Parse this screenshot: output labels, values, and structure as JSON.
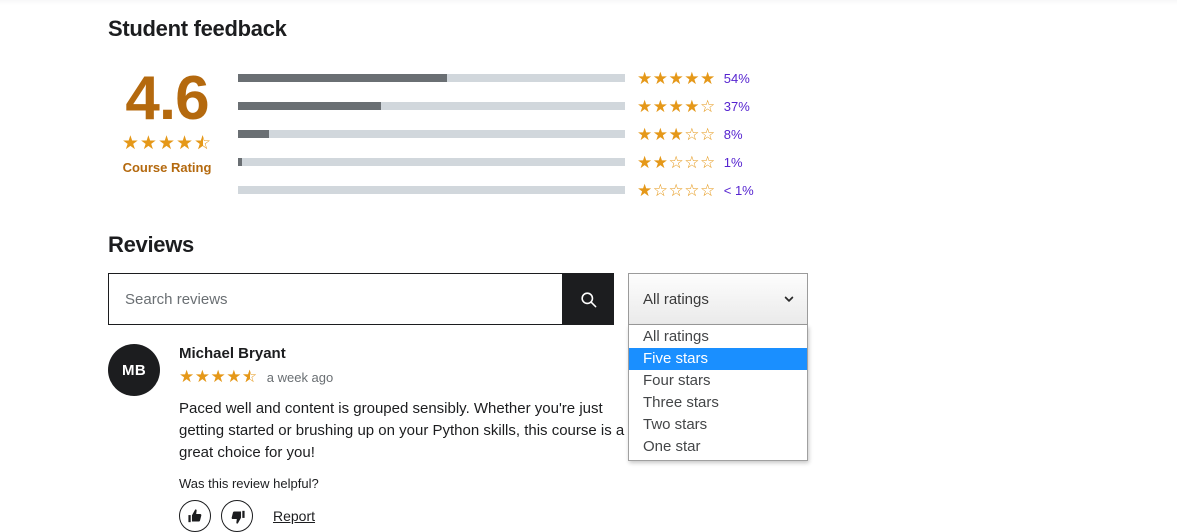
{
  "feedback": {
    "section_title": "Student feedback",
    "average": "4.6",
    "average_stars": 4.6,
    "rating_label": "Course Rating",
    "distribution": [
      {
        "stars": 5,
        "percent_label": "54%",
        "percent": 54
      },
      {
        "stars": 4,
        "percent_label": "37%",
        "percent": 37
      },
      {
        "stars": 3,
        "percent_label": "8%",
        "percent": 8
      },
      {
        "stars": 2,
        "percent_label": "1%",
        "percent": 1
      },
      {
        "stars": 1,
        "percent_label": "< 1%",
        "percent": 0
      }
    ]
  },
  "reviews": {
    "section_title": "Reviews",
    "search": {
      "placeholder": "Search reviews",
      "value": "",
      "button_icon": "search-icon"
    },
    "rating_filter": {
      "selected": "All ratings",
      "chevron_icon": "chevron-down-icon",
      "options": [
        {
          "label": "All ratings",
          "selected": false
        },
        {
          "label": "Five stars",
          "selected": true
        },
        {
          "label": "Four stars",
          "selected": false
        },
        {
          "label": "Three stars",
          "selected": false
        },
        {
          "label": "Two stars",
          "selected": false
        },
        {
          "label": "One star",
          "selected": false
        }
      ]
    },
    "items": [
      {
        "initials": "MB",
        "name": "Michael Bryant",
        "stars": 4.5,
        "time": "a week ago",
        "text": "Paced well and content is grouped sensibly. Whether you're just getting started or brushing up on your Python skills, this course is a great choice for you!",
        "helpful_question": "Was this review helpful?",
        "thumbs_up_icon": "thumbs-up-icon",
        "thumbs_down_icon": "thumbs-down-icon",
        "report_label": "Report"
      }
    ]
  },
  "colors": {
    "star": "#e59819",
    "rating_number": "#b4690e",
    "link_purple": "#5624d0",
    "bar_fill": "#6a6f73",
    "bar_track": "#d1d7dc",
    "dark": "#1c1d1f",
    "highlight_blue": "#1a8fff"
  }
}
